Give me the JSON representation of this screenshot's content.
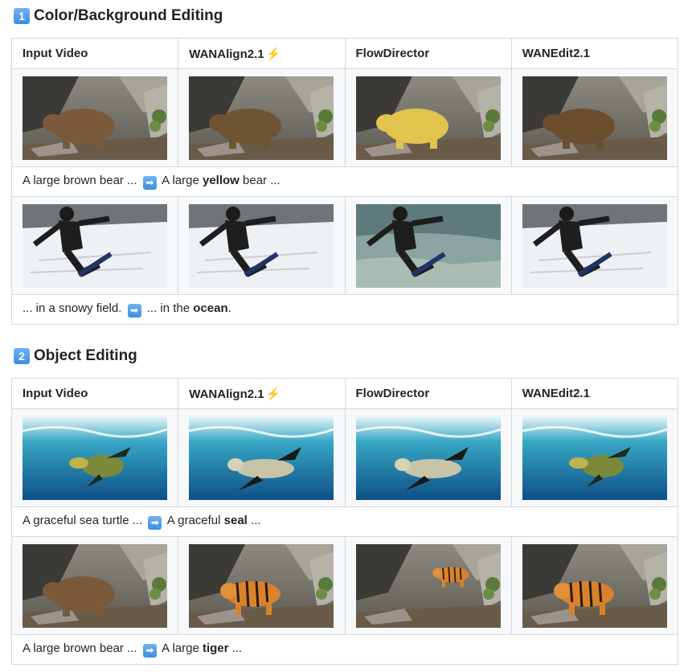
{
  "sections": [
    {
      "number": "1",
      "title": "Color/Background Editing",
      "headers": [
        "Input Video",
        "WANAlign2.1",
        "FlowDirector",
        "WANEdit2.1"
      ],
      "header_icon": "⚡",
      "rows": [
        {
          "scene": "bear",
          "cells": [
            "brown-bear",
            "brown-bear",
            "yellow-bear",
            "brown-bear"
          ],
          "caption": {
            "before": "A large brown bear ...",
            "after_prefix": "A large ",
            "after_bold": "yellow",
            "after_suffix": " bear ..."
          }
        },
        {
          "scene": "snowboard",
          "cells": [
            "snow",
            "snow",
            "ocean",
            "snow"
          ],
          "caption": {
            "before": "... in a snowy field.",
            "after_prefix": "... in the ",
            "after_bold": "ocean",
            "after_suffix": "."
          }
        }
      ]
    },
    {
      "number": "2",
      "title": "Object Editing",
      "headers": [
        "Input Video",
        "WANAlign2.1",
        "FlowDirector",
        "WANEdit2.1"
      ],
      "header_icon": "⚡",
      "rows": [
        {
          "scene": "turtle",
          "cells": [
            "turtle",
            "seal",
            "seal",
            "turtle-seal"
          ],
          "caption": {
            "before": "A graceful sea turtle ...",
            "after_prefix": "A graceful ",
            "after_bold": "seal",
            "after_suffix": " ..."
          }
        },
        {
          "scene": "bear-tiger",
          "cells": [
            "brown-bear",
            "tiger",
            "tiger-small",
            "tiger"
          ],
          "caption": {
            "before": "A large brown bear ...",
            "after_prefix": "A large ",
            "after_bold": "tiger",
            "after_suffix": " ..."
          }
        }
      ]
    }
  ],
  "arrow_icon": "➡",
  "colors": {
    "border": "#d1d9e0",
    "image_row_bg": "#f6f8fa",
    "badge": "#3d8ee0",
    "bolt": "#f08a1c"
  }
}
